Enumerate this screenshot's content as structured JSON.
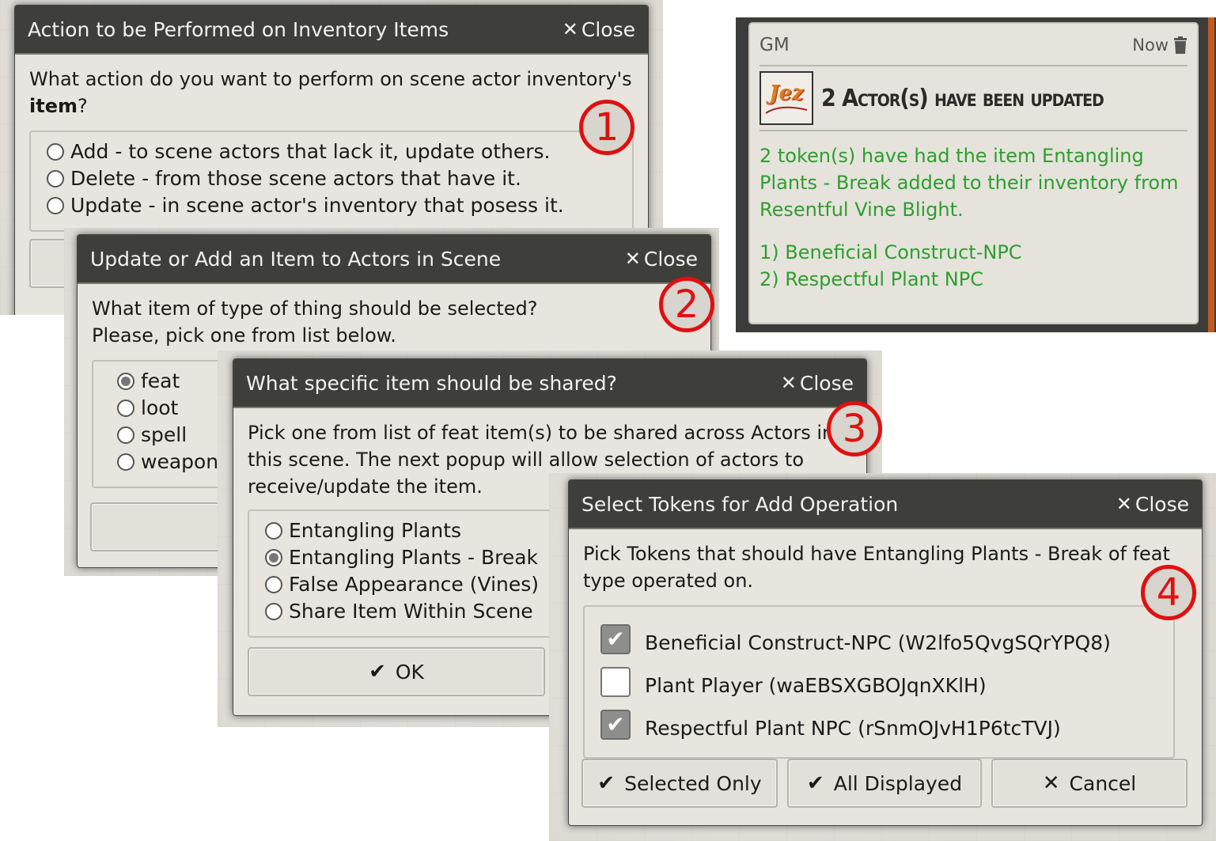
{
  "colors": {
    "header_bg": "#3e3e3a",
    "badge_red": "#e01010",
    "chat_green": "#2e9e2e",
    "chat_header": "#4a4a48"
  },
  "dialog1": {
    "title": "Action to be Performed on Inventory Items",
    "close_label": "Close",
    "prompt_text": "What action do you want to perform on scene actor inventory's",
    "prompt_bold": "item",
    "prompt_end": "?",
    "options": [
      {
        "label": "Add - to scene actors that lack it, update others.",
        "selected": false
      },
      {
        "label": "Delete - from those scene actors that have it.",
        "selected": false
      },
      {
        "label": "Update - in scene actor's inventory that posess it.",
        "selected": false
      }
    ],
    "badge": "1"
  },
  "dialog2": {
    "title": "Update or Add an Item to Actors in Scene",
    "close_label": "Close",
    "prompt_line1": "What item of type of thing should be selected?",
    "prompt_line2": "Please, pick one from list below.",
    "options": [
      {
        "label": "feat",
        "selected": true
      },
      {
        "label": "loot",
        "selected": false
      },
      {
        "label": "spell",
        "selected": false
      },
      {
        "label": "weapon",
        "selected": false
      }
    ],
    "badge": "2"
  },
  "dialog3": {
    "title": "What specific item should be shared?",
    "close_label": "Close",
    "prompt_line1": "Pick one from list of feat item(s) to be shared across Actors in",
    "prompt_line2": "this scene. The next popup will allow selection of actors to",
    "prompt_line3": "receive/update the item.",
    "options": [
      {
        "label": "Entangling Plants",
        "selected": false
      },
      {
        "label": "Entangling Plants - Break",
        "selected": true
      },
      {
        "label": "False Appearance (Vines)",
        "selected": false
      },
      {
        "label": "Share Item Within Scene",
        "selected": false
      }
    ],
    "ok_label": "OK",
    "badge": "3"
  },
  "dialog4": {
    "title": "Select Tokens for Add Operation",
    "close_label": "Close",
    "prompt_line1": "Pick Tokens that should have Entangling Plants - Break of feat",
    "prompt_line2": "type operated on.",
    "tokens": [
      {
        "label": "Beneficial Construct-NPC (W2lfo5QvgSQrYPQ8)",
        "checked": true
      },
      {
        "label": "Plant Player (waEBSXGBOJqnXKlH)",
        "checked": false
      },
      {
        "label": "Respectful Plant NPC (rSnmOJvH1P6tcTVJ)",
        "checked": true
      }
    ],
    "buttons": {
      "selected_only": "Selected Only",
      "all_displayed": "All Displayed",
      "cancel": "Cancel"
    },
    "badge": "4"
  },
  "chat": {
    "speaker": "GM",
    "timestamp": "Now",
    "avatar_text": "Jez",
    "card_title": "2 Actor(s) have been updated",
    "line1": "2 token(s) have had the item Entangling",
    "line2": "Plants - Break added to their inventory from",
    "line3": "Resentful Vine Blight.",
    "list_item1": "1) Beneficial Construct-NPC",
    "list_item2": "2) Respectful Plant NPC"
  }
}
